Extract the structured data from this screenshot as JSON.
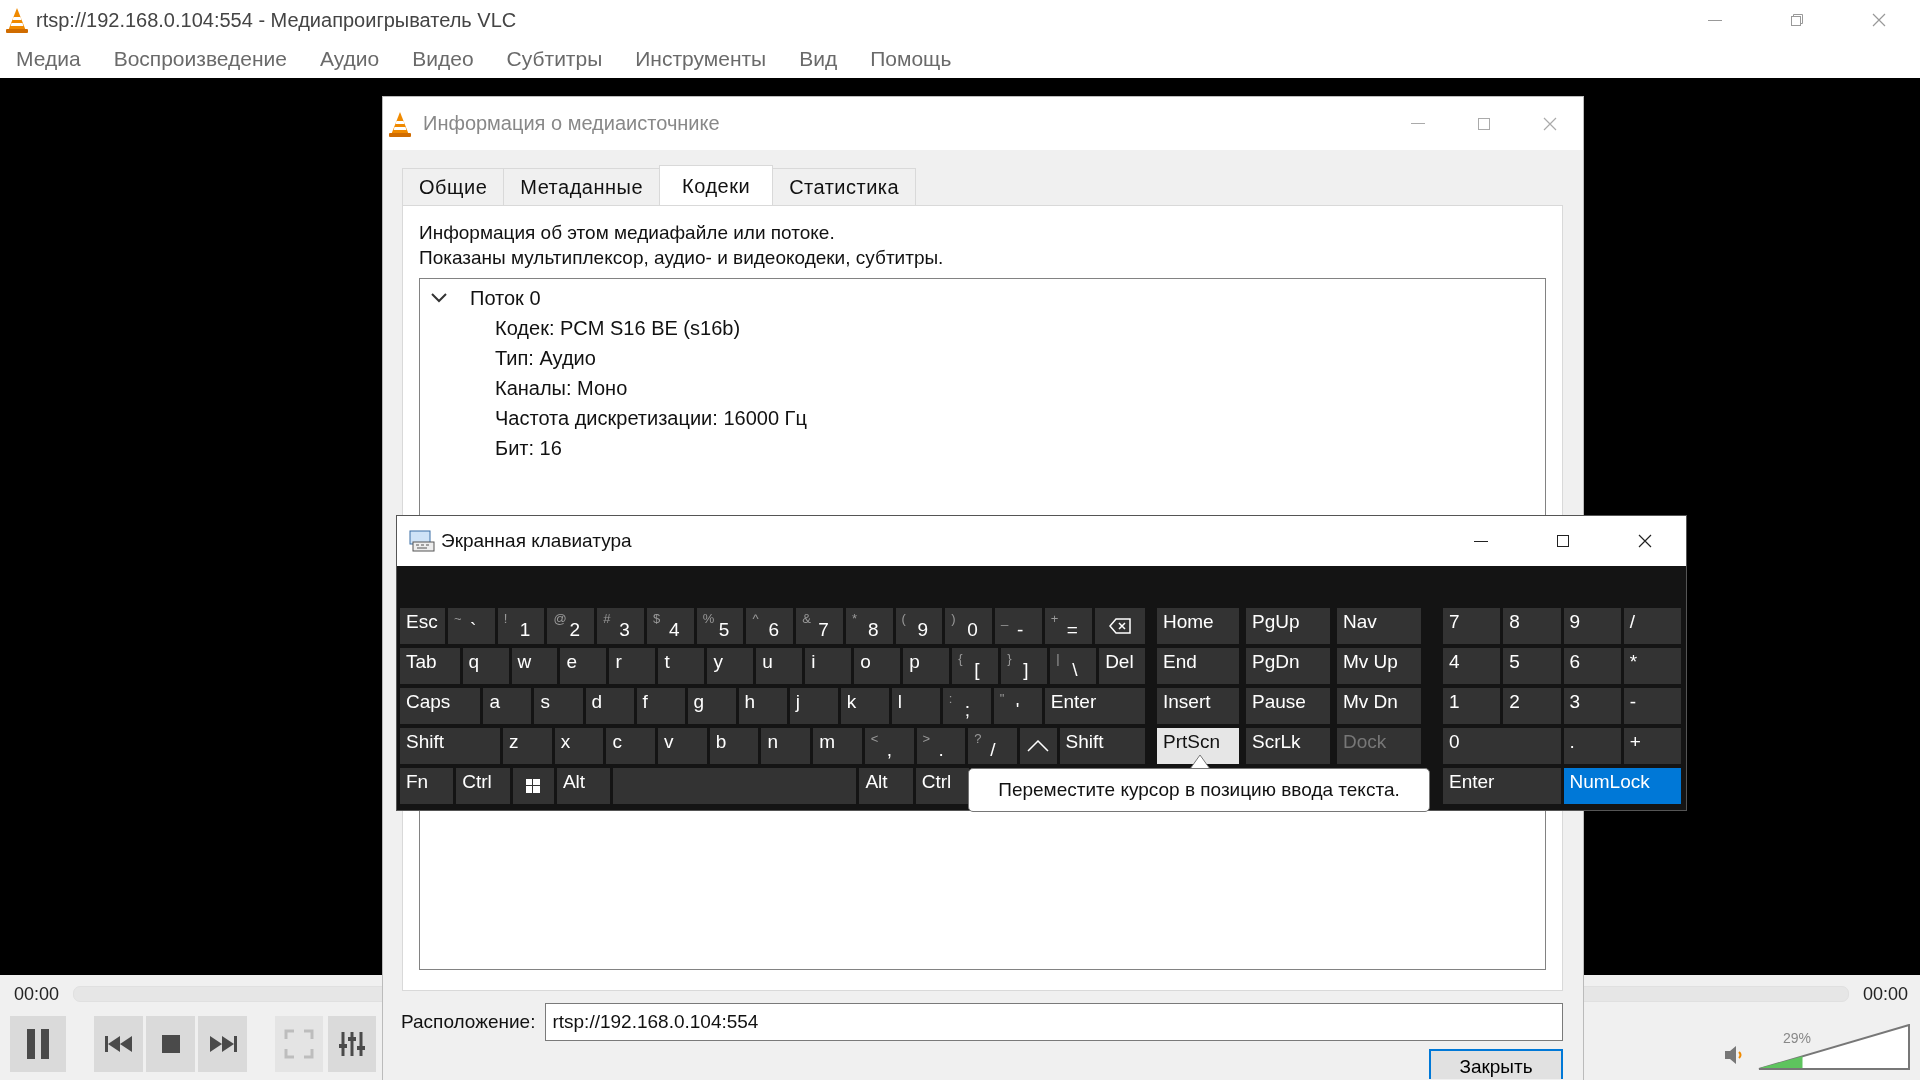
{
  "window": {
    "title": "rtsp://192.168.0.104:554 - Медиапроигрыватель VLC"
  },
  "menu": [
    "Медиа",
    "Воспроизведение",
    "Аудио",
    "Видео",
    "Субтитры",
    "Инструменты",
    "Вид",
    "Помощь"
  ],
  "player": {
    "elapsed": "00:00",
    "remaining": "00:00"
  },
  "controls": [
    {
      "kind": "pause",
      "disabled": false
    },
    {
      "kind": "previous",
      "disabled": false
    },
    {
      "kind": "stop",
      "disabled": false
    },
    {
      "kind": "next",
      "disabled": false
    },
    {
      "kind": "fullscreen",
      "disabled": true
    },
    {
      "kind": "equalizer",
      "disabled": false
    }
  ],
  "volume": {
    "reading": "29%",
    "level": 0.29
  },
  "media_info": {
    "title": "Информация о медиаисточнике",
    "tabs": [
      {
        "label": "Общие",
        "selected": false
      },
      {
        "label": "Метаданные",
        "selected": false
      },
      {
        "label": "Кодеки",
        "selected": true
      },
      {
        "label": "Статистика",
        "selected": false
      }
    ],
    "description": [
      "Информация об этом медиафайле или потоке.",
      "Показаны мультиплексор, аудио- и видеокодеки, субтитры."
    ],
    "tree": [
      {
        "label": "Поток 0",
        "expanded": true,
        "children": [
          {
            "label": "Кодек: PCM S16 BE (s16b)"
          },
          {
            "label": "Тип: Аудио"
          },
          {
            "label": "Каналы: Моно"
          },
          {
            "label": "Частота дискретизации: 16000 Гц"
          },
          {
            "label": "Бит: 16"
          }
        ]
      }
    ],
    "location_label": "Расположение:",
    "location": "rtsp://192.168.0.104:554",
    "close_button": "Закрыть"
  },
  "keyboard": {
    "title": "Экранная клавиатура",
    "main_rows": [
      [
        {
          "kind": "key",
          "label": "Esc"
        },
        {
          "kind": "key",
          "shift": "~",
          "label": "`"
        },
        {
          "kind": "key",
          "shift": "!",
          "label": "1"
        },
        {
          "kind": "key",
          "shift": "@",
          "label": "2"
        },
        {
          "kind": "key",
          "shift": "#",
          "label": "3"
        },
        {
          "kind": "key",
          "shift": "$",
          "label": "4"
        },
        {
          "kind": "key",
          "shift": "%",
          "label": "5"
        },
        {
          "kind": "key",
          "shift": "^",
          "label": "6"
        },
        {
          "kind": "key",
          "shift": "&",
          "label": "7"
        },
        {
          "kind": "key",
          "shift": "*",
          "label": "8"
        },
        {
          "kind": "key",
          "shift": "(",
          "label": "9"
        },
        {
          "kind": "key",
          "shift": ")",
          "label": "0"
        },
        {
          "kind": "key",
          "shift": "_",
          "label": "-"
        },
        {
          "kind": "key",
          "shift": "+",
          "label": "="
        },
        {
          "kind": "backspace"
        }
      ],
      [
        {
          "kind": "key",
          "label": "Tab"
        },
        {
          "kind": "key",
          "label": "q"
        },
        {
          "kind": "key",
          "label": "w"
        },
        {
          "kind": "key",
          "label": "e"
        },
        {
          "kind": "key",
          "label": "r"
        },
        {
          "kind": "key",
          "label": "t"
        },
        {
          "kind": "key",
          "label": "y"
        },
        {
          "kind": "key",
          "label": "u"
        },
        {
          "kind": "key",
          "label": "i"
        },
        {
          "kind": "key",
          "label": "o"
        },
        {
          "kind": "key",
          "label": "p"
        },
        {
          "kind": "key",
          "shift": "{",
          "label": "["
        },
        {
          "kind": "key",
          "shift": "}",
          "label": "]"
        },
        {
          "kind": "key",
          "shift": "|",
          "label": "\\"
        },
        {
          "kind": "key",
          "label": "Del"
        }
      ],
      [
        {
          "kind": "key",
          "label": "Caps"
        },
        {
          "kind": "key",
          "label": "a"
        },
        {
          "kind": "key",
          "label": "s"
        },
        {
          "kind": "key",
          "label": "d"
        },
        {
          "kind": "key",
          "label": "f"
        },
        {
          "kind": "key",
          "label": "g"
        },
        {
          "kind": "key",
          "label": "h"
        },
        {
          "kind": "key",
          "label": "j"
        },
        {
          "kind": "key",
          "label": "k"
        },
        {
          "kind": "key",
          "label": "l"
        },
        {
          "kind": "key",
          "shift": ":",
          "label": ";"
        },
        {
          "kind": "key",
          "shift": "\"",
          "label": "'"
        },
        {
          "kind": "key",
          "label": "Enter"
        }
      ],
      [
        {
          "kind": "key",
          "label": "Shift"
        },
        {
          "kind": "key",
          "label": "z"
        },
        {
          "kind": "key",
          "label": "x"
        },
        {
          "kind": "key",
          "label": "c"
        },
        {
          "kind": "key",
          "label": "v"
        },
        {
          "kind": "key",
          "label": "b"
        },
        {
          "kind": "key",
          "label": "n"
        },
        {
          "kind": "key",
          "label": "m"
        },
        {
          "kind": "key",
          "shift": "<",
          "label": ","
        },
        {
          "kind": "key",
          "shift": ">",
          "label": "."
        },
        {
          "kind": "key",
          "shift": "?",
          "label": "/"
        },
        {
          "kind": "up"
        },
        {
          "kind": "key",
          "label": "Shift"
        }
      ],
      [
        {
          "kind": "key",
          "label": "Fn"
        },
        {
          "kind": "key",
          "label": "Ctrl"
        },
        {
          "kind": "windows"
        },
        {
          "kind": "key",
          "label": "Alt"
        },
        {
          "kind": "space"
        },
        {
          "kind": "key",
          "label": "Alt"
        },
        {
          "kind": "key",
          "label": "Ctrl"
        }
      ]
    ],
    "nav_keys": [
      {
        "label": "Home",
        "hovered": false,
        "disabled": false
      },
      {
        "label": "PgUp",
        "hovered": false,
        "disabled": false
      },
      {
        "label": "Nav",
        "hovered": false,
        "disabled": false
      },
      {
        "label": "End",
        "hovered": false,
        "disabled": false
      },
      {
        "label": "PgDn",
        "hovered": false,
        "disabled": false
      },
      {
        "label": "Mv Up",
        "hovered": false,
        "disabled": false
      },
      {
        "label": "Insert",
        "hovered": false,
        "disabled": false
      },
      {
        "label": "Pause",
        "hovered": false,
        "disabled": false
      },
      {
        "label": "Mv Dn",
        "hovered": false,
        "disabled": false
      },
      {
        "label": "PrtScn",
        "hovered": true,
        "disabled": false
      },
      {
        "label": "ScrLk",
        "hovered": false,
        "disabled": false
      },
      {
        "label": "Dock",
        "hovered": false,
        "disabled": true
      }
    ],
    "numpad": [
      {
        "label": "7",
        "kind": "single",
        "on": false
      },
      {
        "label": "8",
        "kind": "single",
        "on": false
      },
      {
        "label": "9",
        "kind": "single",
        "on": false
      },
      {
        "label": "/",
        "kind": "single",
        "on": false
      },
      {
        "label": "4",
        "kind": "single",
        "on": false
      },
      {
        "label": "5",
        "kind": "single",
        "on": false
      },
      {
        "label": "6",
        "kind": "single",
        "on": false
      },
      {
        "label": "*",
        "kind": "single",
        "on": false
      },
      {
        "label": "1",
        "kind": "single",
        "on": false
      },
      {
        "label": "2",
        "kind": "single",
        "on": false
      },
      {
        "label": "3",
        "kind": "single",
        "on": false
      },
      {
        "label": "-",
        "kind": "single",
        "on": false
      },
      {
        "label": "0",
        "kind": "double",
        "on": false
      },
      {
        "label": ".",
        "kind": "single",
        "on": false
      },
      {
        "label": "+",
        "kind": "single",
        "on": false
      },
      {
        "label": "Enter",
        "kind": "double",
        "on": false
      },
      {
        "label": "NumLock",
        "kind": "double",
        "on": true
      }
    ],
    "tooltip": "Переместите курсор в позицию ввода текста."
  }
}
